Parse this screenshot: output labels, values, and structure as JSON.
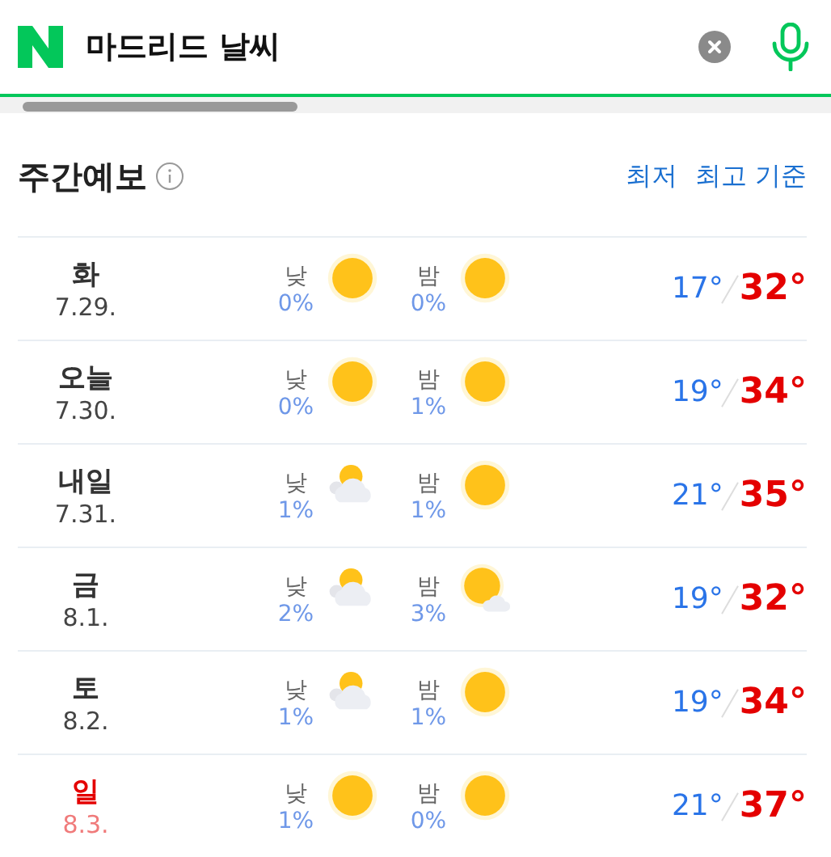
{
  "search": {
    "value": "마드리드 날씨"
  },
  "section": {
    "title": "주간예보",
    "sort_links": [
      "최저",
      "최고 기준"
    ]
  },
  "days": [
    {
      "day": "화",
      "date": "7.29.",
      "holiday": false,
      "am": {
        "label": "낮",
        "rain": "0%",
        "kind": "sunny"
      },
      "pm": {
        "label": "밤",
        "rain": "0%",
        "kind": "sunny"
      },
      "low": "17°",
      "high": "32°"
    },
    {
      "day": "오늘",
      "date": "7.30.",
      "holiday": false,
      "am": {
        "label": "낮",
        "rain": "0%",
        "kind": "sunny"
      },
      "pm": {
        "label": "밤",
        "rain": "1%",
        "kind": "sunny"
      },
      "low": "19°",
      "high": "34°"
    },
    {
      "day": "내일",
      "date": "7.31.",
      "holiday": false,
      "am": {
        "label": "낮",
        "rain": "1%",
        "kind": "partly_cloudy"
      },
      "pm": {
        "label": "밤",
        "rain": "1%",
        "kind": "sunny"
      },
      "low": "21°",
      "high": "35°"
    },
    {
      "day": "금",
      "date": "8.1.",
      "holiday": false,
      "am": {
        "label": "낮",
        "rain": "2%",
        "kind": "partly_cloudy"
      },
      "pm": {
        "label": "밤",
        "rain": "3%",
        "kind": "sun_small_cloud"
      },
      "low": "19°",
      "high": "32°"
    },
    {
      "day": "토",
      "date": "8.2.",
      "holiday": false,
      "am": {
        "label": "낮",
        "rain": "1%",
        "kind": "partly_cloudy"
      },
      "pm": {
        "label": "밤",
        "rain": "1%",
        "kind": "sunny"
      },
      "low": "19°",
      "high": "34°"
    },
    {
      "day": "일",
      "date": "8.3.",
      "holiday": true,
      "am": {
        "label": "낮",
        "rain": "1%",
        "kind": "sunny"
      },
      "pm": {
        "label": "밤",
        "rain": "0%",
        "kind": "sunny"
      },
      "low": "21°",
      "high": "37°"
    }
  ]
}
